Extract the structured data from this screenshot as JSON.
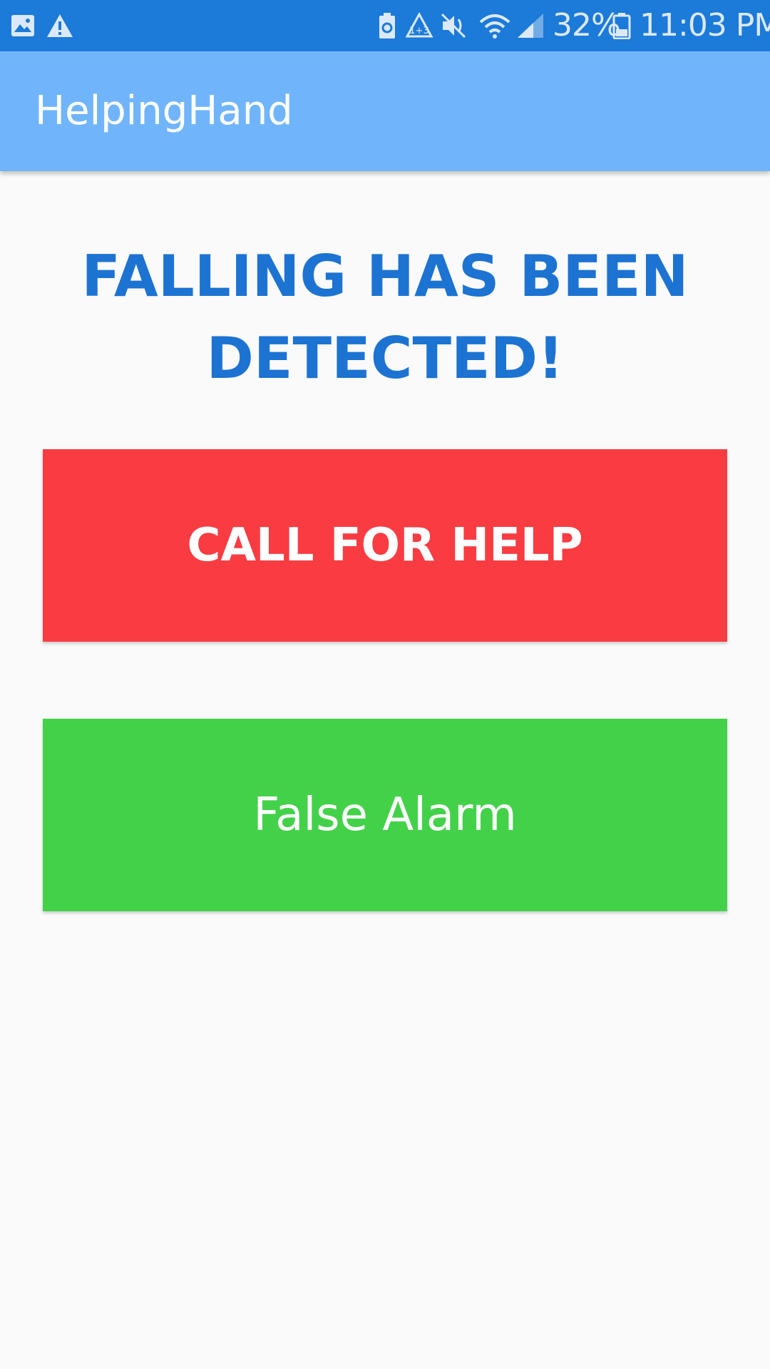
{
  "status_bar": {
    "battery_percent": "32%",
    "time": "11:03 PM",
    "icons": [
      "gallery-icon",
      "warning-icon",
      "battery-saver-icon",
      "recycle-icon",
      "mute-icon",
      "wifi-icon",
      "signal-icon",
      "battery-icon"
    ]
  },
  "app_bar": {
    "title": "HelpingHand"
  },
  "main": {
    "heading": "FALLING HAS BEEN DETECTED!",
    "call_button_label": "CALL FOR HELP",
    "false_alarm_label": "False Alarm"
  },
  "colors": {
    "status_bar": "#1c7ad8",
    "app_bar": "#70b5fc",
    "heading": "#1c73d2",
    "call_button": "#f93c41",
    "false_alarm_button": "#43d149",
    "background": "#fafafa"
  }
}
